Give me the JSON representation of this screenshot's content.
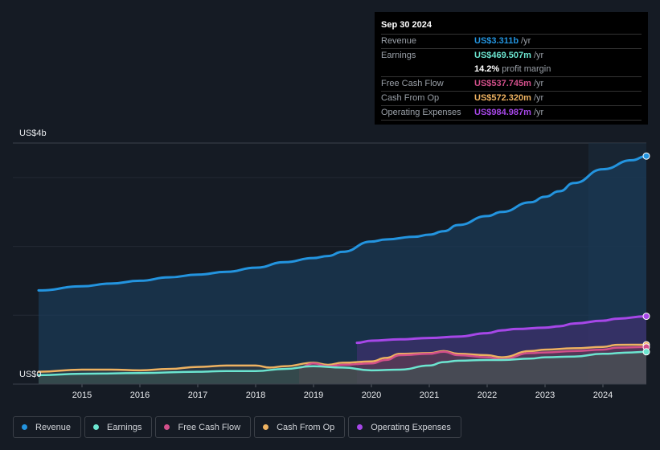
{
  "tooltip": {
    "date": "Sep 30 2024",
    "rows": [
      {
        "label": "Revenue",
        "value": "US$3.311b",
        "unit": "/yr",
        "color": "#2394df"
      },
      {
        "label": "Earnings",
        "value": "US$469.507m",
        "unit": "/yr",
        "color": "#6ce5d0"
      },
      {
        "label": "",
        "value": "14.2%",
        "unit": "profit margin",
        "color": "#ffffff"
      },
      {
        "label": "Free Cash Flow",
        "value": "US$537.745m",
        "unit": "/yr",
        "color": "#d24f8a"
      },
      {
        "label": "Cash From Op",
        "value": "US$572.320m",
        "unit": "/yr",
        "color": "#eeb261"
      },
      {
        "label": "Operating Expenses",
        "value": "US$984.987m",
        "unit": "/yr",
        "color": "#a647e8"
      }
    ]
  },
  "legend": [
    {
      "label": "Revenue",
      "color": "#2394df"
    },
    {
      "label": "Earnings",
      "color": "#6ce5d0"
    },
    {
      "label": "Free Cash Flow",
      "color": "#d24f8a"
    },
    {
      "label": "Cash From Op",
      "color": "#eeb261"
    },
    {
      "label": "Operating Expenses",
      "color": "#a647e8"
    }
  ],
  "chart_data": {
    "type": "area",
    "title": "",
    "ylabel": "",
    "xlabel": "",
    "y_top_label": "US$4b",
    "y_bottom_label": "US$0",
    "ylim": [
      0,
      3.5
    ],
    "xlim": [
      2014.25,
      2024.75
    ],
    "x_ticks": [
      "2015",
      "2016",
      "2017",
      "2018",
      "2019",
      "2020",
      "2021",
      "2022",
      "2023",
      "2024"
    ],
    "highlight_from": 2023.75,
    "units": "US$ billions",
    "series": [
      {
        "name": "Revenue",
        "color": "#2394df",
        "x": [
          2014.25,
          2015,
          2015.5,
          2016,
          2016.5,
          2017,
          2017.5,
          2018,
          2018.5,
          2019,
          2019.25,
          2019.5,
          2020,
          2020.25,
          2020.75,
          2021,
          2021.25,
          2021.5,
          2022,
          2022.25,
          2022.75,
          2023,
          2023.25,
          2023.5,
          2024,
          2024.5,
          2024.75
        ],
        "values": [
          1.36,
          1.42,
          1.46,
          1.5,
          1.55,
          1.59,
          1.63,
          1.69,
          1.77,
          1.83,
          1.86,
          1.92,
          2.07,
          2.1,
          2.14,
          2.17,
          2.22,
          2.31,
          2.44,
          2.5,
          2.64,
          2.72,
          2.8,
          2.92,
          3.12,
          3.25,
          3.311
        ]
      },
      {
        "name": "Earnings",
        "color": "#6ce5d0",
        "x": [
          2014.25,
          2015,
          2016,
          2017,
          2017.5,
          2018,
          2018.5,
          2019,
          2019.5,
          2020,
          2020.5,
          2021,
          2021.25,
          2021.5,
          2022,
          2022.25,
          2022.75,
          2023,
          2023.5,
          2024,
          2024.5,
          2024.75
        ],
        "values": [
          0.13,
          0.15,
          0.16,
          0.18,
          0.19,
          0.19,
          0.22,
          0.26,
          0.24,
          0.2,
          0.21,
          0.27,
          0.32,
          0.34,
          0.35,
          0.35,
          0.37,
          0.39,
          0.4,
          0.44,
          0.46,
          0.4695
        ]
      },
      {
        "name": "Free Cash Flow",
        "color": "#d24f8a",
        "x": [
          2018.75,
          2019,
          2019.25,
          2019.5,
          2020,
          2020.25,
          2020.5,
          2021,
          2021.25,
          2021.5,
          2022,
          2022.25,
          2022.75,
          2023,
          2023.5,
          2024,
          2024.25,
          2024.75
        ],
        "values": [
          0.24,
          0.3,
          0.26,
          0.28,
          0.3,
          0.35,
          0.42,
          0.44,
          0.47,
          0.42,
          0.39,
          0.36,
          0.45,
          0.46,
          0.48,
          0.5,
          0.53,
          0.5377
        ]
      },
      {
        "name": "Cash From Op",
        "color": "#eeb261",
        "x": [
          2014.25,
          2015,
          2015.5,
          2016,
          2016.5,
          2017,
          2017.5,
          2018,
          2018.25,
          2018.5,
          2019,
          2019.25,
          2019.5,
          2020,
          2020.25,
          2020.5,
          2021,
          2021.25,
          2021.5,
          2022,
          2022.25,
          2022.75,
          2023,
          2023.5,
          2024,
          2024.25,
          2024.75
        ],
        "values": [
          0.18,
          0.21,
          0.21,
          0.2,
          0.22,
          0.25,
          0.27,
          0.27,
          0.24,
          0.26,
          0.31,
          0.28,
          0.31,
          0.33,
          0.38,
          0.44,
          0.45,
          0.48,
          0.44,
          0.42,
          0.39,
          0.48,
          0.5,
          0.52,
          0.54,
          0.57,
          0.5723
        ]
      },
      {
        "name": "Operating Expenses",
        "color": "#a647e8",
        "x": [
          2019.75,
          2020,
          2020.5,
          2021,
          2021.5,
          2022,
          2022.25,
          2022.5,
          2023,
          2023.25,
          2023.5,
          2024,
          2024.25,
          2024.75
        ],
        "values": [
          0.6,
          0.63,
          0.65,
          0.67,
          0.69,
          0.74,
          0.78,
          0.8,
          0.82,
          0.84,
          0.88,
          0.92,
          0.95,
          0.985
        ]
      }
    ]
  }
}
